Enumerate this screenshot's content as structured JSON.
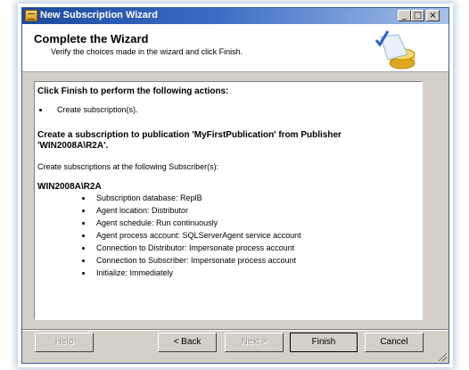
{
  "window": {
    "title": "New Subscription Wizard",
    "controls": {
      "minimize": "_",
      "maximize": "□",
      "close": "×"
    }
  },
  "header": {
    "title": "Complete the Wizard",
    "subtitle": "Verify the choices made in the wizard and click Finish."
  },
  "content": {
    "heading1": "Click Finish to perform the following actions:",
    "action_bullet": "Create subscription(s).",
    "heading2_line1": "Create a subscription to publication 'MyFirstPublication' from Publisher",
    "heading2_line2": "'WIN2008A\\R2A'.",
    "subscribers_text": "Create subscriptions at the following Subscriber(s):",
    "subscriber_name": "WIN2008A\\R2A",
    "details": [
      "Subscription database: ReplB",
      "Agent location: Distributor",
      "Agent schedule: Run continuously",
      "Agent process account: SQLServerAgent service account",
      "Connection to Distributor: Impersonate process account",
      "Connection to Subscriber: Impersonate process account",
      "Initialize: Immediately"
    ]
  },
  "buttons": {
    "help": "Help",
    "back": "< Back",
    "next": "Next >",
    "finish": "Finish",
    "cancel": "Cancel"
  },
  "icons": {
    "app": "wizard-app-icon",
    "header": "checkmark-database-icon",
    "grip": "resize-grip-icon"
  },
  "colors": {
    "titlebar_start": "#1b4a9c",
    "titlebar_end": "#a6c1e8",
    "dialog_face": "#d4d0c8"
  }
}
